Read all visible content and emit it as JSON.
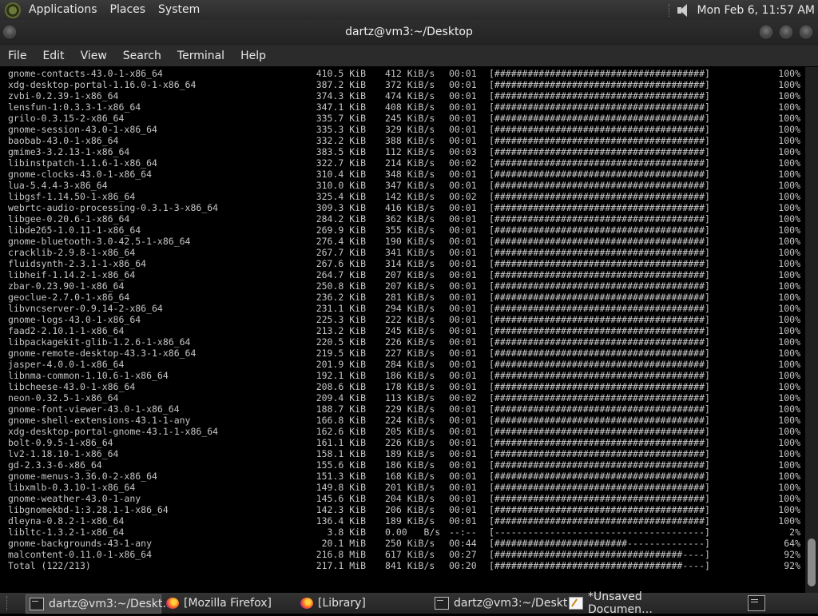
{
  "top_panel": {
    "menus": [
      "Applications",
      "Places",
      "System"
    ],
    "clock": "Mon Feb  6, 11:57 AM"
  },
  "window": {
    "title": "dartz@vm3:~/Desktop"
  },
  "menubar": [
    "File",
    "Edit",
    "View",
    "Search",
    "Terminal",
    "Help"
  ],
  "terminal": {
    "lines": [
      [
        "gnome-contacts-43.0-1-x86_64",
        "410.5 KiB",
        "412 KiB/s",
        "00:01",
        "[######################################]",
        "100%"
      ],
      [
        "xdg-desktop-portal-1.16.0-1-x86_64",
        "387.2 KiB",
        "372 KiB/s",
        "00:01",
        "[######################################]",
        "100%"
      ],
      [
        "zvbi-0.2.39-1-x86_64",
        "374.3 KiB",
        "474 KiB/s",
        "00:01",
        "[######################################]",
        "100%"
      ],
      [
        "lensfun-1:0.3.3-1-x86_64",
        "347.1 KiB",
        "408 KiB/s",
        "00:01",
        "[######################################]",
        "100%"
      ],
      [
        "grilo-0.3.15-2-x86_64",
        "335.7 KiB",
        "245 KiB/s",
        "00:01",
        "[######################################]",
        "100%"
      ],
      [
        "gnome-session-43.0-1-x86_64",
        "335.3 KiB",
        "329 KiB/s",
        "00:01",
        "[######################################]",
        "100%"
      ],
      [
        "baobab-43.0-1-x86_64",
        "332.2 KiB",
        "388 KiB/s",
        "00:01",
        "[######################################]",
        "100%"
      ],
      [
        "gmime3-3.2.13-1-x86_64",
        "383.5 KiB",
        "112 KiB/s",
        "00:03",
        "[######################################]",
        "100%"
      ],
      [
        "libinstpatch-1.1.6-1-x86_64",
        "322.7 KiB",
        "214 KiB/s",
        "00:02",
        "[######################################]",
        "100%"
      ],
      [
        "gnome-clocks-43.0-1-x86_64",
        "310.4 KiB",
        "348 KiB/s",
        "00:01",
        "[######################################]",
        "100%"
      ],
      [
        "lua-5.4.4-3-x86_64",
        "310.0 KiB",
        "347 KiB/s",
        "00:01",
        "[######################################]",
        "100%"
      ],
      [
        "libgsf-1.14.50-1-x86_64",
        "325.4 KiB",
        "142 KiB/s",
        "00:02",
        "[######################################]",
        "100%"
      ],
      [
        "webrtc-audio-processing-0.3.1-3-x86_64",
        "309.3 KiB",
        "416 KiB/s",
        "00:01",
        "[######################################]",
        "100%"
      ],
      [
        "libgee-0.20.6-1-x86_64",
        "284.2 KiB",
        "362 KiB/s",
        "00:01",
        "[######################################]",
        "100%"
      ],
      [
        "libde265-1.0.11-1-x86_64",
        "269.9 KiB",
        "355 KiB/s",
        "00:01",
        "[######################################]",
        "100%"
      ],
      [
        "gnome-bluetooth-3.0-42.5-1-x86_64",
        "276.4 KiB",
        "190 KiB/s",
        "00:01",
        "[######################################]",
        "100%"
      ],
      [
        "cracklib-2.9.8-1-x86_64",
        "267.7 KiB",
        "341 KiB/s",
        "00:01",
        "[######################################]",
        "100%"
      ],
      [
        "fluidsynth-2.3.1-1-x86_64",
        "267.6 KiB",
        "314 KiB/s",
        "00:01",
        "[######################################]",
        "100%"
      ],
      [
        "libheif-1.14.2-1-x86_64",
        "264.7 KiB",
        "207 KiB/s",
        "00:01",
        "[######################################]",
        "100%"
      ],
      [
        "zbar-0.23.90-1-x86_64",
        "250.8 KiB",
        "207 KiB/s",
        "00:01",
        "[######################################]",
        "100%"
      ],
      [
        "geoclue-2.7.0-1-x86_64",
        "236.2 KiB",
        "281 KiB/s",
        "00:01",
        "[######################################]",
        "100%"
      ],
      [
        "libvncserver-0.9.14-2-x86_64",
        "231.1 KiB",
        "294 KiB/s",
        "00:01",
        "[######################################]",
        "100%"
      ],
      [
        "gnome-logs-43.0-1-x86_64",
        "225.3 KiB",
        "222 KiB/s",
        "00:01",
        "[######################################]",
        "100%"
      ],
      [
        "faad2-2.10.1-1-x86_64",
        "213.2 KiB",
        "245 KiB/s",
        "00:01",
        "[######################################]",
        "100%"
      ],
      [
        "libpackagekit-glib-1.2.6-1-x86_64",
        "220.5 KiB",
        "226 KiB/s",
        "00:01",
        "[######################################]",
        "100%"
      ],
      [
        "gnome-remote-desktop-43.3-1-x86_64",
        "219.5 KiB",
        "227 KiB/s",
        "00:01",
        "[######################################]",
        "100%"
      ],
      [
        "jasper-4.0.0-1-x86_64",
        "201.9 KiB",
        "284 KiB/s",
        "00:01",
        "[######################################]",
        "100%"
      ],
      [
        "libnma-common-1.10.6-1-x86_64",
        "192.1 KiB",
        "186 KiB/s",
        "00:01",
        "[######################################]",
        "100%"
      ],
      [
        "libcheese-43.0-1-x86_64",
        "208.6 KiB",
        "178 KiB/s",
        "00:01",
        "[######################################]",
        "100%"
      ],
      [
        "neon-0.32.5-1-x86_64",
        "209.4 KiB",
        "113 KiB/s",
        "00:02",
        "[######################################]",
        "100%"
      ],
      [
        "gnome-font-viewer-43.0-1-x86_64",
        "188.7 KiB",
        "229 KiB/s",
        "00:01",
        "[######################################]",
        "100%"
      ],
      [
        "gnome-shell-extensions-43.1-1-any",
        "166.8 KiB",
        "224 KiB/s",
        "00:01",
        "[######################################]",
        "100%"
      ],
      [
        "xdg-desktop-portal-gnome-43.1-1-x86_64",
        "162.6 KiB",
        "205 KiB/s",
        "00:01",
        "[######################################]",
        "100%"
      ],
      [
        "bolt-0.9.5-1-x86_64",
        "161.1 KiB",
        "226 KiB/s",
        "00:01",
        "[######################################]",
        "100%"
      ],
      [
        "lv2-1.18.10-1-x86_64",
        "158.1 KiB",
        "189 KiB/s",
        "00:01",
        "[######################################]",
        "100%"
      ],
      [
        "gd-2.3.3-6-x86_64",
        "155.6 KiB",
        "186 KiB/s",
        "00:01",
        "[######################################]",
        "100%"
      ],
      [
        "gnome-menus-3.36.0-2-x86_64",
        "151.3 KiB",
        "168 KiB/s",
        "00:01",
        "[######################################]",
        "100%"
      ],
      [
        "libxmlb-0.3.10-1-x86_64",
        "149.8 KiB",
        "201 KiB/s",
        "00:01",
        "[######################################]",
        "100%"
      ],
      [
        "gnome-weather-43.0-1-any",
        "145.6 KiB",
        "204 KiB/s",
        "00:01",
        "[######################################]",
        "100%"
      ],
      [
        "libgnomekbd-1:3.28.1-1-x86_64",
        "142.3 KiB",
        "206 KiB/s",
        "00:01",
        "[######################################]",
        "100%"
      ],
      [
        "dleyna-0.8.2-1-x86_64",
        "136.4 KiB",
        "189 KiB/s",
        "00:01",
        "[######################################]",
        "100%"
      ],
      [
        "libltc-1.3.2-1-x86_64",
        "3.8 KiB",
        "0.00   B/s",
        "--:--",
        "[--------------------------------------]",
        "2%"
      ],
      [
        "gnome-backgrounds-43-1-any",
        "20.1 MiB",
        "250 KiB/s",
        "00:44",
        "[########################--------------]",
        "64%"
      ],
      [
        "malcontent-0.11.0-1-x86_64",
        "216.8 MiB",
        "617 KiB/s",
        "00:27",
        "[##################################----]",
        "92%"
      ],
      [
        "Total (122/213)",
        "217.1 MiB",
        "841 KiB/s",
        "00:20",
        "[##################################----]",
        "92%"
      ]
    ]
  },
  "taskbar": {
    "items": [
      {
        "label": "dartz@vm3:~/Deskt…",
        "icon": "terminal-icon"
      },
      {
        "label": "[Mozilla Firefox]",
        "icon": "firefox-icon"
      },
      {
        "label": "[Library]",
        "icon": "firefox-icon"
      },
      {
        "label": "dartz@vm3:~/Deskt…",
        "icon": "terminal-icon"
      },
      {
        "label": "*Unsaved Documen…",
        "icon": "text-editor-icon"
      }
    ]
  }
}
